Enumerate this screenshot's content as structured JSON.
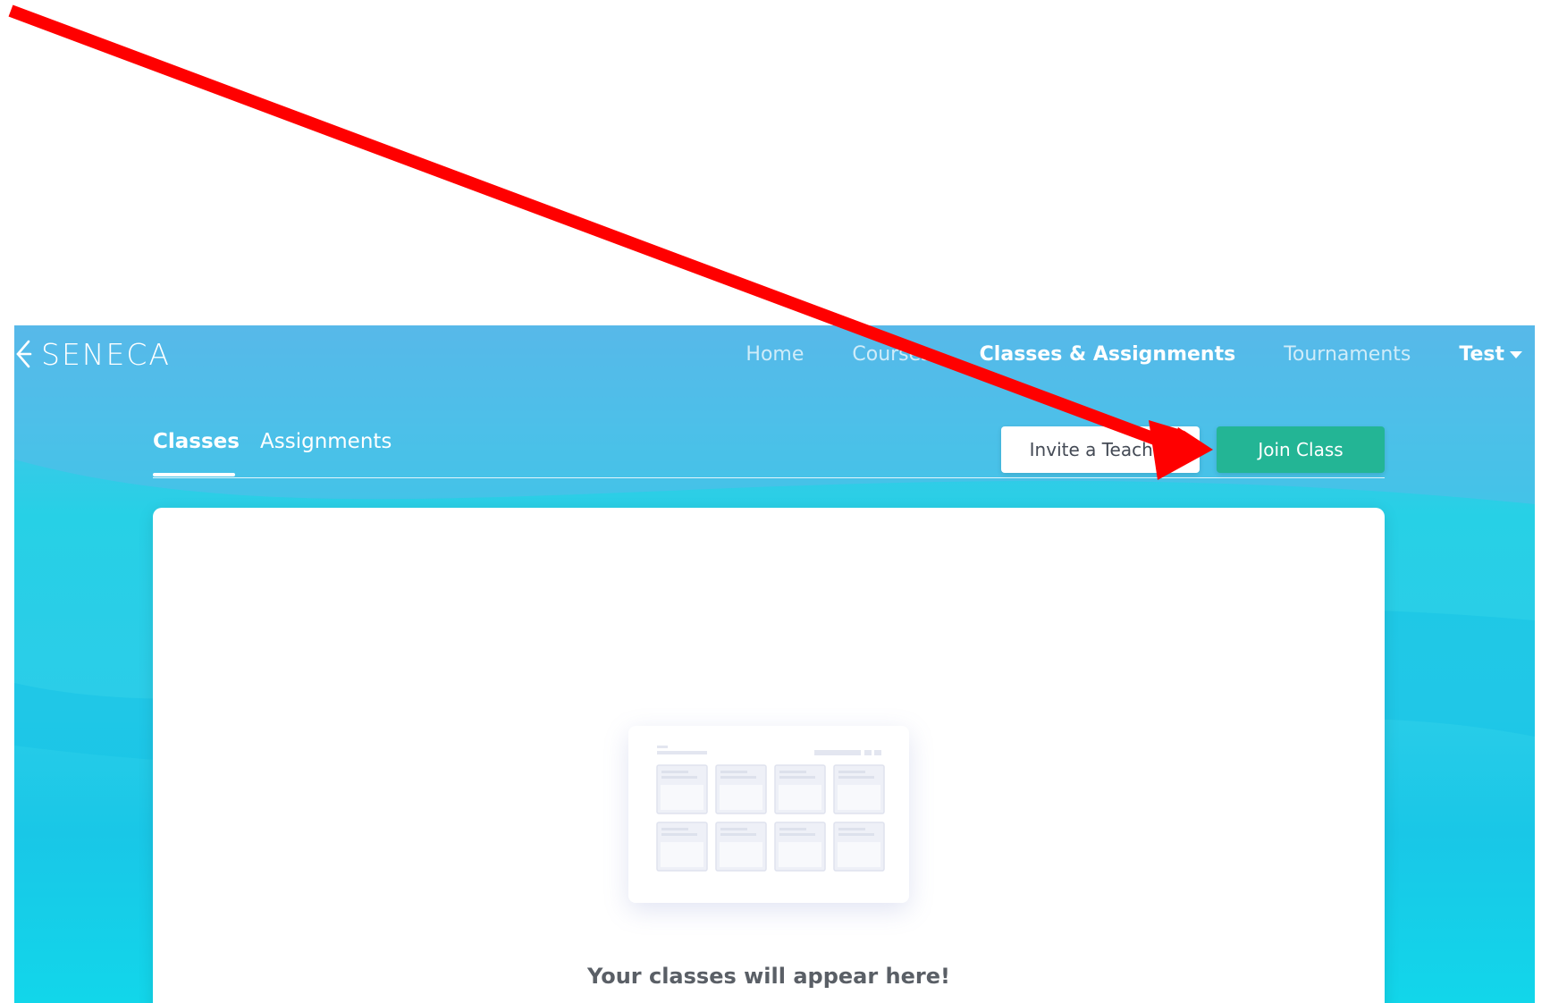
{
  "app": {
    "brand": "SENECA",
    "nav": [
      {
        "label": "Home",
        "active": false
      },
      {
        "label": "Courses",
        "active": false
      },
      {
        "label": "Classes & Assignments",
        "active": true
      },
      {
        "label": "Tournaments",
        "active": false
      }
    ],
    "user_menu_label": "Test",
    "tabs": [
      {
        "label": "Classes",
        "active": true
      },
      {
        "label": "Assignments",
        "active": false
      }
    ],
    "buttons": {
      "invite_label": "Invite a Teacher",
      "join_label": "Join Class"
    },
    "empty_state": {
      "message": "Your classes will appear here!"
    }
  },
  "annotation": {
    "type": "arrow",
    "color": "#ff0000",
    "target": "join-class-button"
  },
  "colors": {
    "accent_green": "#23b595",
    "header_blue": "#55b7e9",
    "cyan": "#19c7e7"
  }
}
